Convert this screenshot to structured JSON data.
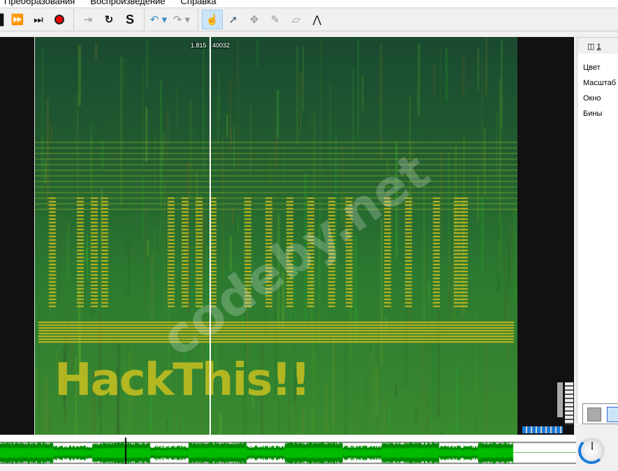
{
  "menu": [
    "Преобразования",
    "Воспроизведение",
    "Справка"
  ],
  "toolbar": {
    "icons": [
      "play-icon",
      "fast-forward-icon",
      "skip-end-icon",
      "record-icon",
      "play-selection-icon",
      "loop-icon",
      "solo-icon",
      "undo-icon",
      "redo-icon",
      "navigate-icon",
      "select-icon",
      "move-icon",
      "draw-icon",
      "erase-icon",
      "measure-icon"
    ]
  },
  "spectrogram": {
    "time_label": "1.815",
    "freq_label": "40032",
    "cursor_fraction": 0.362,
    "art_text": "HackThis!!",
    "watermark": "codeby.net",
    "colors": {
      "low": "#0d3b25",
      "mid": "#2f8a3a",
      "high": "#d4c420"
    }
  },
  "panel": {
    "tab": "1",
    "properties": [
      "Цвет",
      "Масштаб",
      "Окно",
      "Бины"
    ]
  },
  "overview": {
    "waveform_color": "#00a000"
  }
}
